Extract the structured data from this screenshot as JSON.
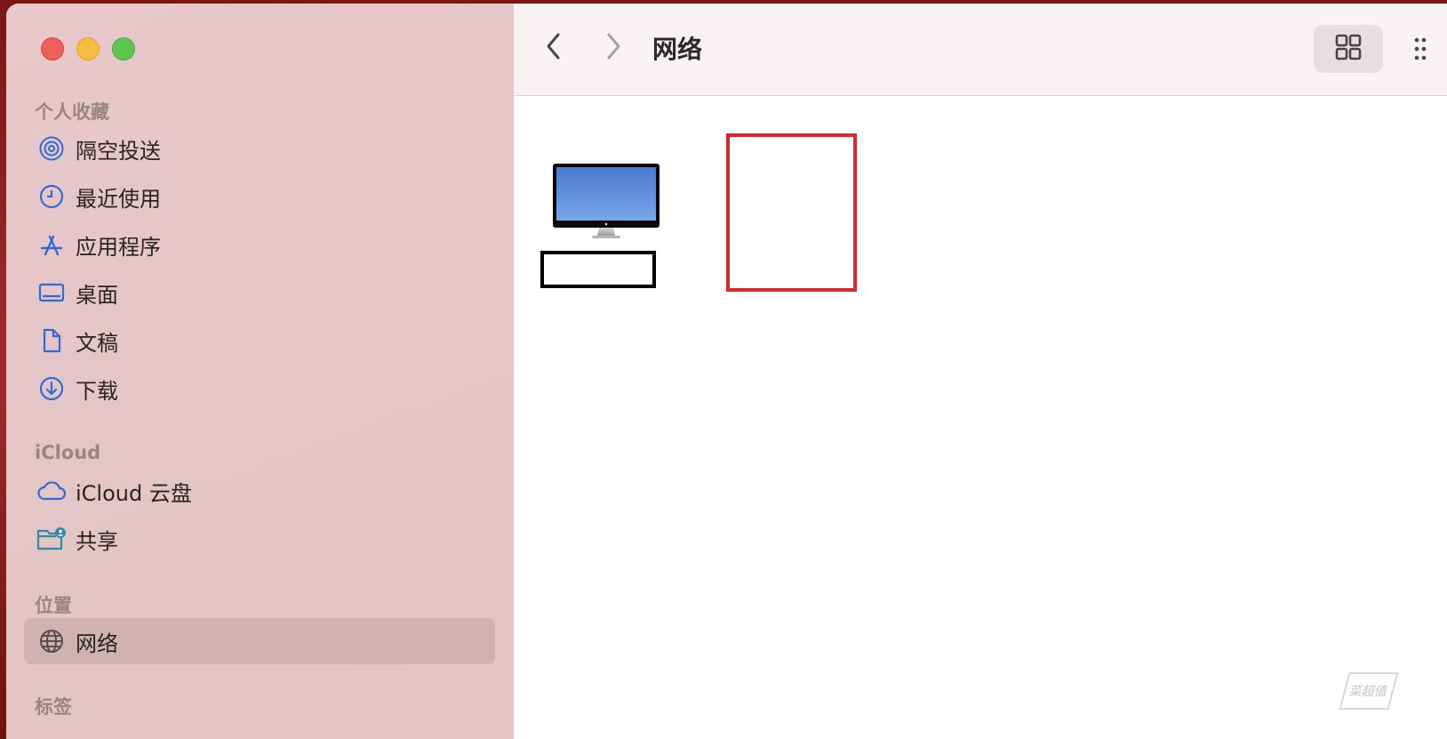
{
  "window": {
    "title": "网络"
  },
  "sidebar": {
    "sections": [
      {
        "title": "个人收藏"
      },
      {
        "title": "iCloud"
      },
      {
        "title": "位置"
      },
      {
        "title": "标签"
      }
    ],
    "favorites": [
      {
        "label": "隔空投送",
        "icon": "airdrop-icon"
      },
      {
        "label": "最近使用",
        "icon": "clock-icon"
      },
      {
        "label": "应用程序",
        "icon": "applications-icon"
      },
      {
        "label": "桌面",
        "icon": "desktop-icon"
      },
      {
        "label": "文稿",
        "icon": "document-icon"
      },
      {
        "label": "下载",
        "icon": "download-icon"
      }
    ],
    "icloud": [
      {
        "label": "iCloud 云盘",
        "icon": "cloud-icon"
      },
      {
        "label": "共享",
        "icon": "shared-folder-icon"
      }
    ],
    "locations": [
      {
        "label": "网络",
        "icon": "network-icon",
        "selected": true
      }
    ]
  },
  "toolbar": {
    "back_icon": "chevron-left-icon",
    "forward_icon": "chevron-right-icon",
    "view_icon": "grid-view-icon"
  },
  "content": {
    "items": [
      {
        "icon": "computer-monitor-icon",
        "name": ""
      },
      {
        "icon": "",
        "name": ""
      }
    ]
  },
  "watermark": {
    "text": "菜超值"
  },
  "colors": {
    "sidebar_bg": "#e5c6c8",
    "accent_icon": "#2f6bd6",
    "highlight_red": "#e0242c"
  }
}
